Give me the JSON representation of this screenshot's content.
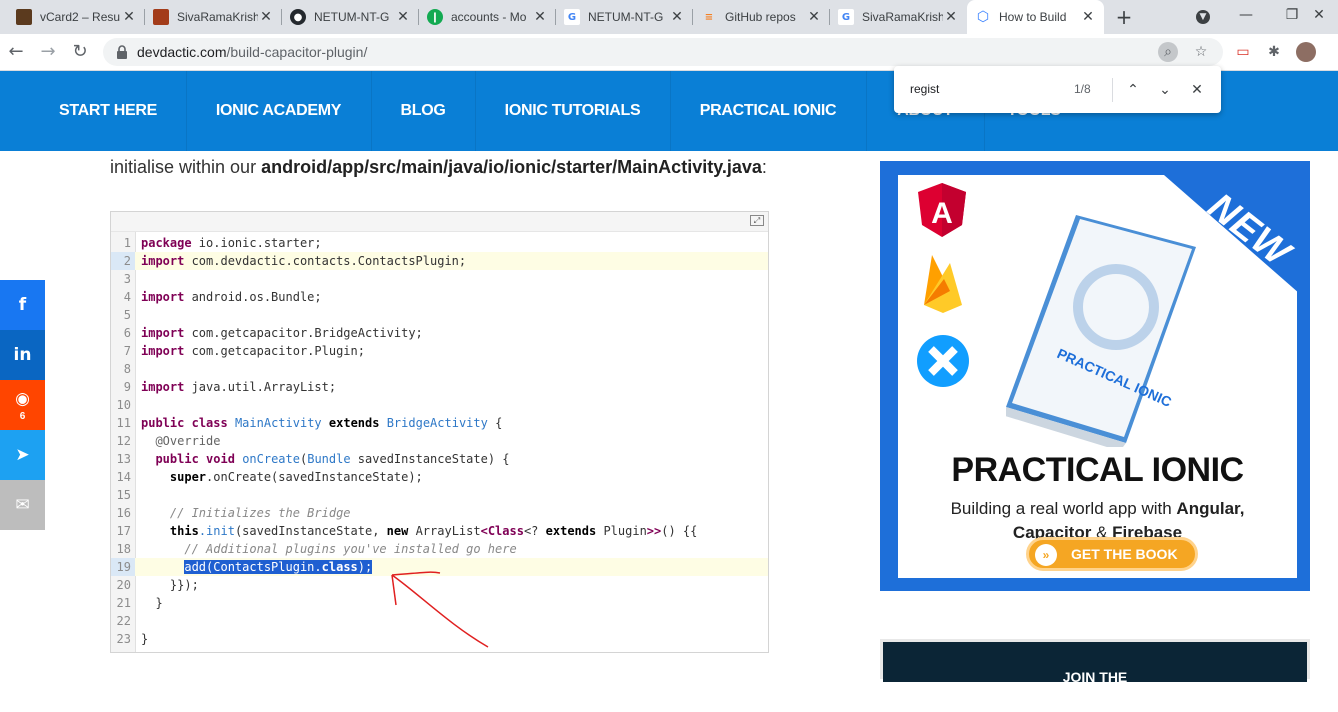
{
  "tabs": [
    {
      "title": "vCard2 – Resu",
      "favicon": "vcard-favicon",
      "favicon_color": "#5b3a1e"
    },
    {
      "title": "SivaRamaKrish",
      "favicon": "profile-favicon",
      "favicon_color": "#a33c1a"
    },
    {
      "title": "NETUM-NT-G",
      "favicon": "github-icon",
      "favicon_color": "#24292e"
    },
    {
      "title": "accounts - Mo",
      "favicon": "mongodb-icon",
      "favicon_color": "#13aa52"
    },
    {
      "title": "NETUM-NT-G",
      "favicon": "google-icon",
      "favicon_color": "#4285f4"
    },
    {
      "title": "GitHub repos",
      "favicon": "stackoverflow-icon",
      "favicon_color": "#f48024"
    },
    {
      "title": "SivaRamaKrish",
      "favicon": "google-icon",
      "favicon_color": "#4285f4"
    },
    {
      "title": "How to Build",
      "favicon": "ionic-icon",
      "favicon_color": "#3880ff",
      "active": true
    }
  ],
  "address": {
    "domain": "devdactic.com",
    "path": "/build-capacitor-plugin/"
  },
  "find": {
    "query": "regist",
    "count": "1/8"
  },
  "site_nav": [
    "START HERE",
    "IONIC ACADEMY",
    "BLOG",
    "IONIC TUTORIALS",
    "PRACTICAL IONIC",
    "ABOUT",
    "TOOLS"
  ],
  "article": {
    "intro_prefix": "initialise within our ",
    "intro_path": "android/app/src/main/java/io/ionic/starter/MainActivity.java",
    "intro_suffix": ":"
  },
  "code_line_numbers": [
    "1",
    "2",
    "3",
    "4",
    "5",
    "6",
    "7",
    "8",
    "9",
    "10",
    "11",
    "12",
    "13",
    "14",
    "15",
    "16",
    "17",
    "18",
    "19",
    "20",
    "21",
    "22",
    "23"
  ],
  "code": {
    "l1_kw": "package",
    "l1_rest": " io.ionic.starter;",
    "l2_kw": "import",
    "l2_rest": " com.devdactic.contacts.ContactsPlugin;",
    "l4_kw": "import",
    "l4_rest": " android.os.Bundle;",
    "l6_kw": "import",
    "l6_rest": " com.getcapacitor.BridgeActivity;",
    "l7_kw": "import",
    "l7_rest": " com.getcapacitor.Plugin;",
    "l9_kw": "import",
    "l9_rest": " java.util.ArrayList;",
    "l11_public": "public",
    "l11_class": "class",
    "l11_name": "MainActivity",
    "l11_extends": "extends",
    "l11_parent": "BridgeActivity",
    "l11_end": " {",
    "l12": "  @Override",
    "l13_public": "public",
    "l13_void": "void",
    "l13_method": "onCreate",
    "l13_params_open": "(",
    "l13_type": "Bundle",
    "l13_params": " savedInstanceState) {",
    "l14_super": "super",
    "l14_rest": ".onCreate(savedInstanceState);",
    "l16": "// Initializes the Bridge",
    "l17_this": "this",
    "l17_init": ".init",
    "l17_mid": "(savedInstanceState, ",
    "l17_new": "new",
    "l17_al": " ArrayList",
    "l17_lt": "<",
    "l17_class": "Class",
    "l17_q": "<? ",
    "l17_extends": "extends",
    "l17_plugin": " Plugin",
    "l17_gt": ">>",
    "l17_end": "() {{",
    "l18": "// Additional plugins you've installed go here",
    "l19_a": "add(ContactsPlugin.",
    "l19_class": "class",
    "l19_b": ");",
    "l20": "    }});",
    "l21": "  }",
    "l23": "}"
  },
  "share": [
    {
      "icon": "facebook-icon",
      "glyph": "f",
      "color": "#1877f2"
    },
    {
      "icon": "linkedin-icon",
      "glyph": "in",
      "color": "#0a66c2"
    },
    {
      "icon": "reddit-icon",
      "glyph": "◉",
      "color": "#ff4500",
      "count": "6"
    },
    {
      "icon": "twitter-icon",
      "glyph": "🐦",
      "color": "#1da1f2"
    },
    {
      "icon": "email-icon",
      "glyph": "✉",
      "color": "#bdbdbd"
    }
  ],
  "ad": {
    "title": "PRACTICAL IONIC",
    "sub1_plain": "Building a real world app with ",
    "sub1_bold": "Angular,",
    "sub2_a": "Capacitor",
    "sub2_amp": " & ",
    "sub2_b": "Firebase",
    "button": "GET THE BOOK",
    "ribbon": "NEW",
    "book_title": "PRACTICAL IONIC"
  },
  "join": "JOIN THE"
}
